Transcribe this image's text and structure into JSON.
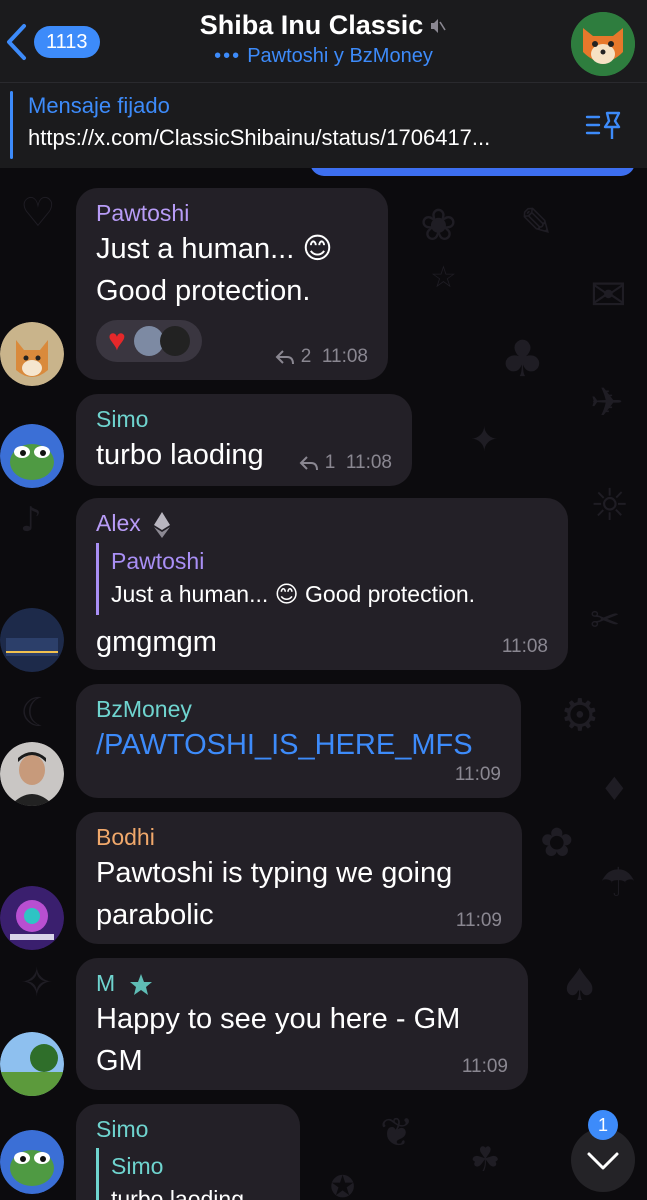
{
  "header": {
    "back_count": "1113",
    "title": "Shiba Inu Classic",
    "subtitle_dots": "•••",
    "subtitle": "Pawtoshi y BzMoney"
  },
  "pinned": {
    "title": "Mensaje fijado",
    "text": "https://x.com/ClassicShibainu/status/1706417..."
  },
  "messages": [
    {
      "sender": "Pawtoshi",
      "sender_color": "#b89cf7",
      "line1": "Just a human... 😊",
      "line2": "Good protection.",
      "replies": "2",
      "time": "11:08"
    },
    {
      "sender": "Simo",
      "sender_color": "#6fd4cf",
      "text": "turbo laoding",
      "replies": "1",
      "time": "11:08"
    },
    {
      "sender": "Alex",
      "sender_color": "#b89cf7",
      "quote_name": "Pawtoshi",
      "quote_text": "Just a human... 😊 Good protection.",
      "text": "gmgmgm",
      "time": "11:08"
    },
    {
      "sender": "BzMoney",
      "sender_color": "#6fd4cf",
      "text": "/PAWTOSHI_IS_HERE_MFS",
      "time": "11:09"
    },
    {
      "sender": "Bodhi",
      "sender_color": "#f0a86b",
      "line1": "Pawtoshi is typing we going",
      "line2": "parabolic",
      "time": "11:09"
    },
    {
      "sender": "M",
      "sender_color": "#6fd4cf",
      "line1": "Happy to see you here - GM",
      "line2": "GM",
      "time": "11:09"
    },
    {
      "sender": "Simo",
      "sender_color": "#6fd4cf",
      "quote_name": "Simo",
      "quote_text": "turbo laoding"
    }
  ],
  "scroll": {
    "unread": "1"
  }
}
